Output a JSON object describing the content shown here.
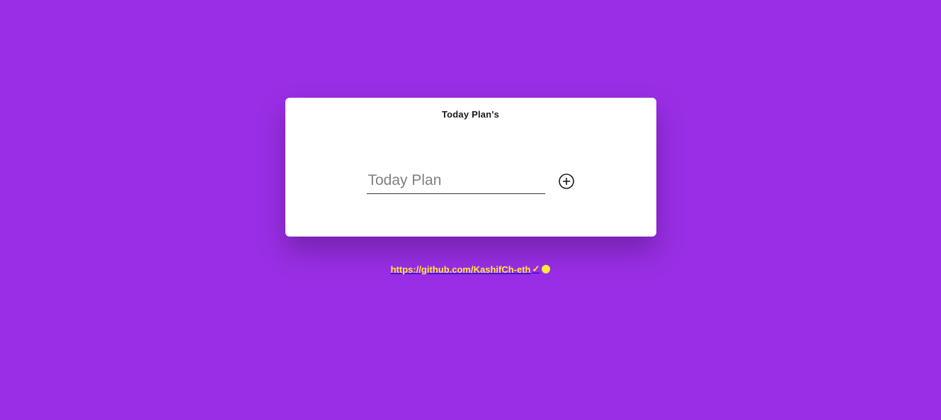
{
  "card": {
    "title": "Today Plan's",
    "input_placeholder": "Today Plan",
    "input_value": ""
  },
  "footer": {
    "link_text": "https://github.com/KashifCh-eth",
    "check_mark": "✓"
  },
  "colors": {
    "background": "#9a2ee6",
    "card_bg": "#ffffff",
    "link_color": "#ffeb3b"
  }
}
